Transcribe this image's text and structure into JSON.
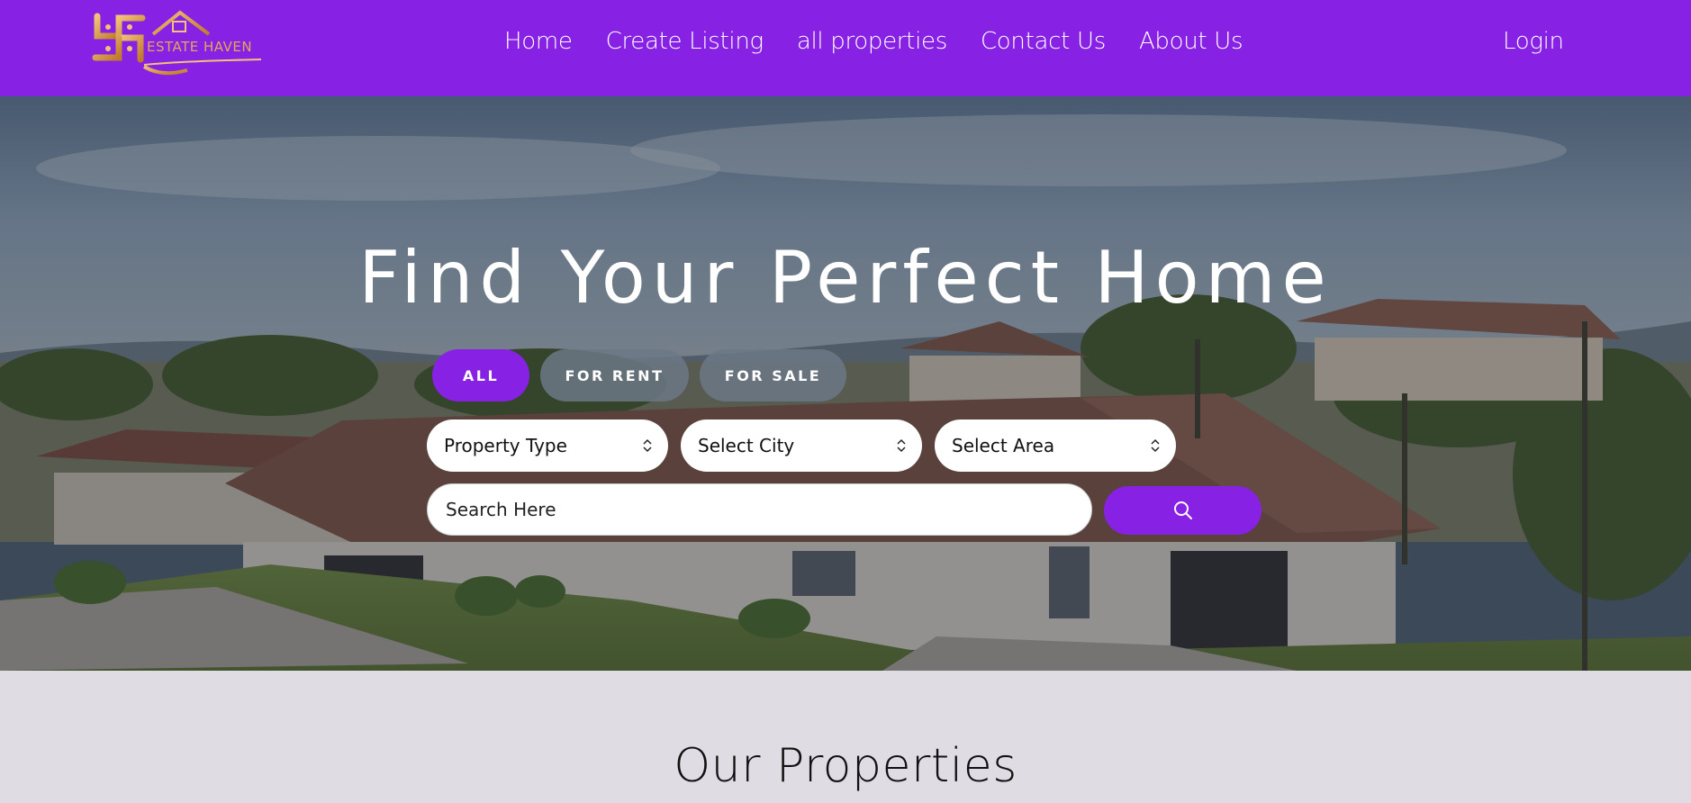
{
  "brand": {
    "logo_text": "ESTATE HAVEN",
    "colors": {
      "accent": "#8722e4",
      "logo_gold": "#e3a75a"
    }
  },
  "nav": {
    "links": [
      "Home",
      "Create Listing",
      "all properties",
      "Contact Us",
      "About Us"
    ],
    "login": "Login"
  },
  "hero": {
    "title": "Find Your Perfect Home",
    "tabs": [
      "ALL",
      "FOR RENT",
      "FOR SALE"
    ],
    "active_tab": "ALL",
    "selects": {
      "property_type": "Property Type",
      "city": "Select City",
      "area": "Select Area"
    },
    "search": {
      "placeholder": "Search Here",
      "button_icon": "search-icon"
    }
  },
  "section": {
    "title": "Our Properties"
  }
}
